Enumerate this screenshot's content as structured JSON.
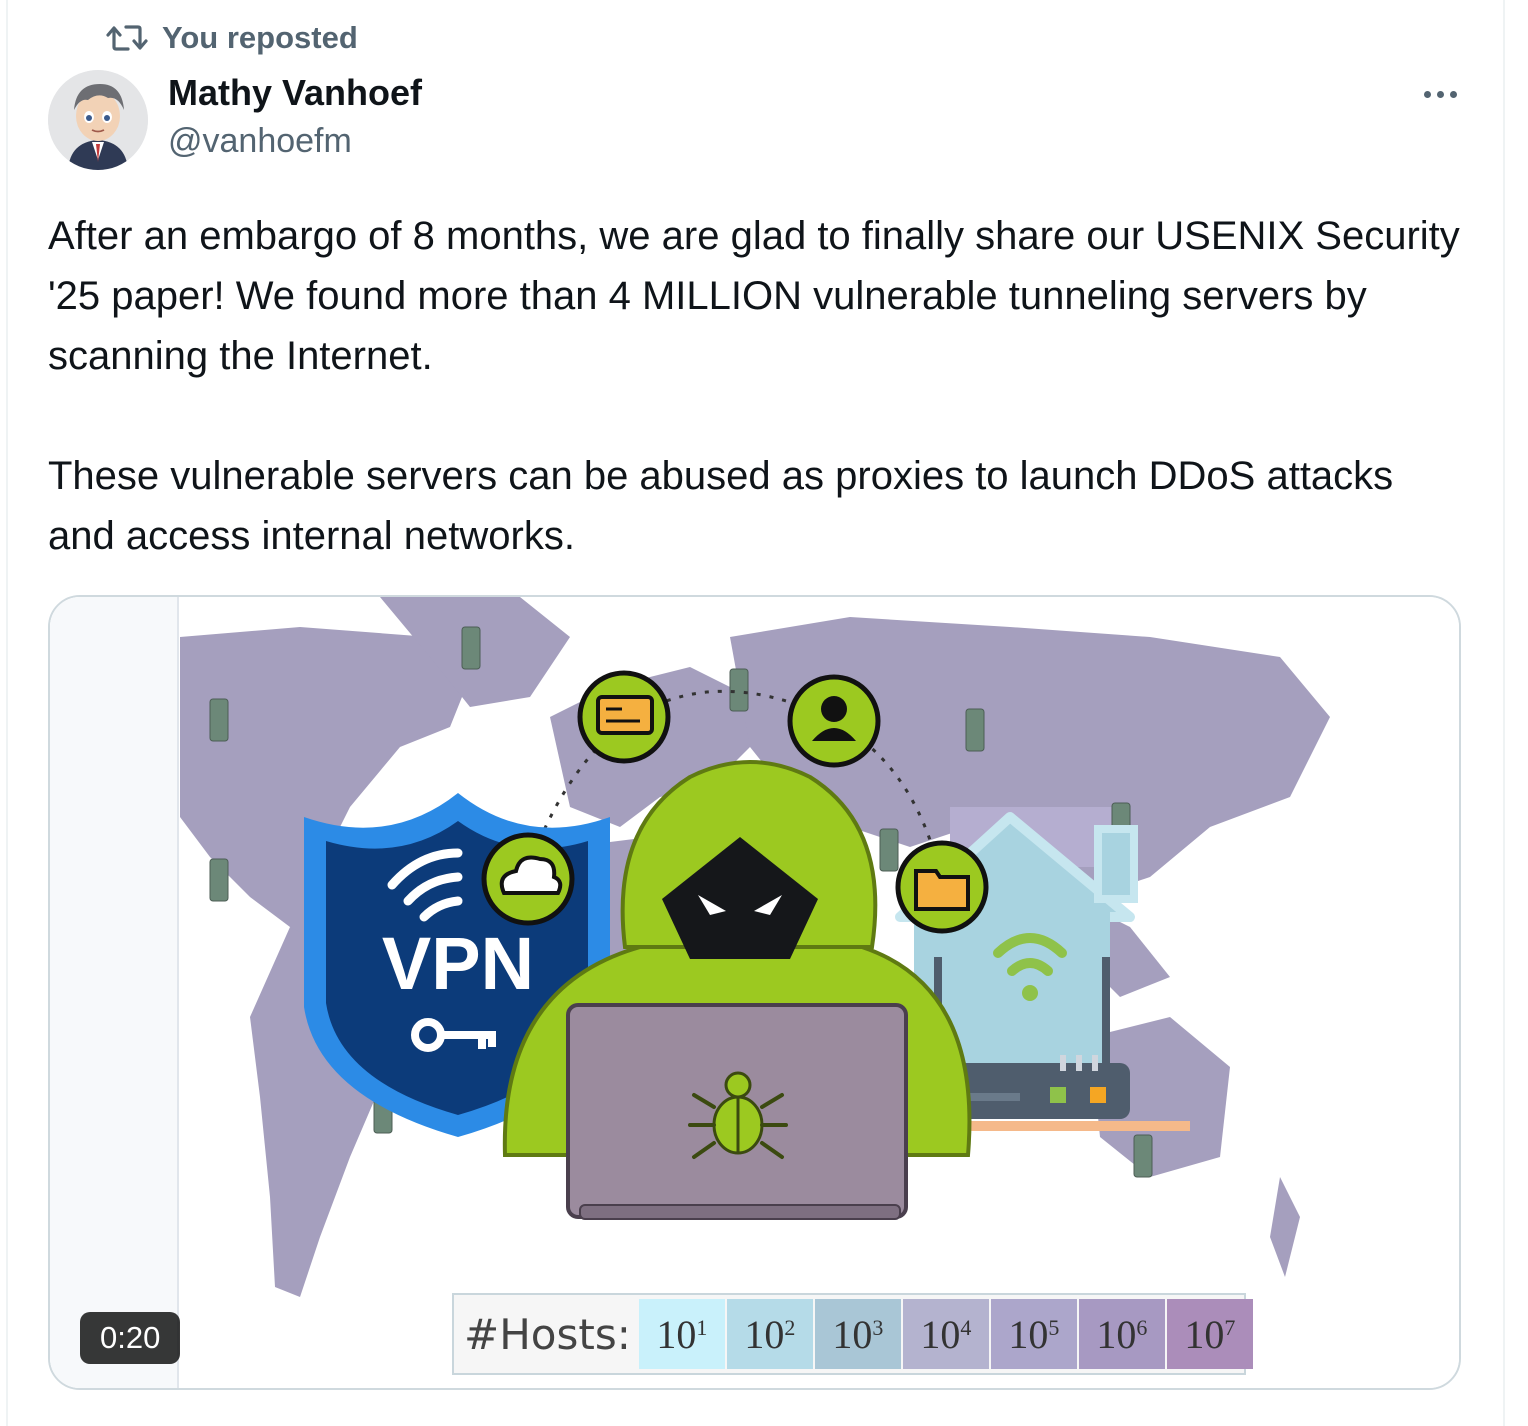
{
  "repost": {
    "label": "You reposted",
    "icon": "repost-icon"
  },
  "author": {
    "name": "Mathy Vanhoef",
    "handle": "@vanhoefm"
  },
  "tweet": {
    "paragraphs": [
      "After an embargo of 8 months, we are glad to finally share our USENIX Security '25 paper! We found more than 4 MILLION vulnerable tunneling servers by scanning the Internet.",
      "These vulnerable servers can be abused as proxies to launch DDoS attacks and access internal networks."
    ]
  },
  "media": {
    "duration": "0:20",
    "illustration": {
      "shield_text": "VPN",
      "legend": {
        "label": "#Hosts:",
        "base": "10",
        "cells": [
          {
            "exp": "1",
            "color": "#c9f1fb"
          },
          {
            "exp": "2",
            "color": "#b5dbe8"
          },
          {
            "exp": "3",
            "color": "#a9c6d6"
          },
          {
            "exp": "4",
            "color": "#b4b3cf"
          },
          {
            "exp": "5",
            "color": "#aca6cb"
          },
          {
            "exp": "6",
            "color": "#a799c2"
          },
          {
            "exp": "7",
            "color": "#ab8dba"
          }
        ]
      }
    }
  },
  "colors": {
    "text_primary": "#0f1419",
    "text_secondary": "#536471",
    "hoodie_green": "#9cc920",
    "map_purple": "#a59fbe",
    "shield_blue": "#1b75d0"
  }
}
